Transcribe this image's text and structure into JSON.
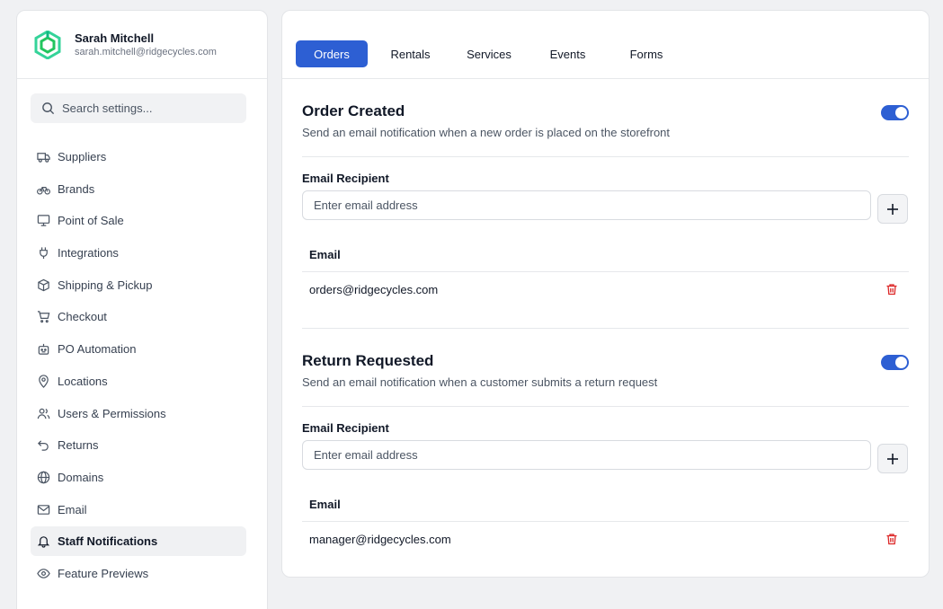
{
  "profile": {
    "name": "Sarah Mitchell",
    "email": "sarah.mitchell@ridgecycles.com"
  },
  "search": {
    "placeholder": "Search settings..."
  },
  "sidebar": {
    "items": [
      {
        "label": "Suppliers",
        "icon": "truck-icon"
      },
      {
        "label": "Brands",
        "icon": "bicycle-icon"
      },
      {
        "label": "Point of Sale",
        "icon": "monitor-icon"
      },
      {
        "label": "Integrations",
        "icon": "plug-icon"
      },
      {
        "label": "Shipping & Pickup",
        "icon": "package-icon"
      },
      {
        "label": "Checkout",
        "icon": "cart-icon"
      },
      {
        "label": "PO Automation",
        "icon": "robot-icon"
      },
      {
        "label": "Locations",
        "icon": "map-pin-icon"
      },
      {
        "label": "Users & Permissions",
        "icon": "users-icon"
      },
      {
        "label": "Returns",
        "icon": "return-arrow-icon"
      },
      {
        "label": "Domains",
        "icon": "globe-icon"
      },
      {
        "label": "Email",
        "icon": "mail-icon"
      },
      {
        "label": "Staff Notifications",
        "icon": "bell-icon",
        "active": true
      },
      {
        "label": "Feature Previews",
        "icon": "eye-icon"
      }
    ]
  },
  "tabs": [
    {
      "label": "Orders",
      "active": true
    },
    {
      "label": "Rentals"
    },
    {
      "label": "Services"
    },
    {
      "label": "Events"
    },
    {
      "label": "Forms"
    }
  ],
  "sections": [
    {
      "title": "Order Created",
      "description": "Send an email notification when a new order is placed on the storefront",
      "enabled": true,
      "recipient_label": "Email Recipient",
      "input_placeholder": "Enter email address",
      "column_header": "Email",
      "emails": [
        "orders@ridgecycles.com"
      ]
    },
    {
      "title": "Return Requested",
      "description": "Send an email notification when a customer submits a return request",
      "enabled": true,
      "recipient_label": "Email Recipient",
      "input_placeholder": "Enter email address",
      "column_header": "Email",
      "emails": [
        "manager@ridgecycles.com"
      ]
    }
  ],
  "colors": {
    "accent": "#2d5fd3",
    "danger": "#dc2626",
    "logo": "#22c55e"
  }
}
